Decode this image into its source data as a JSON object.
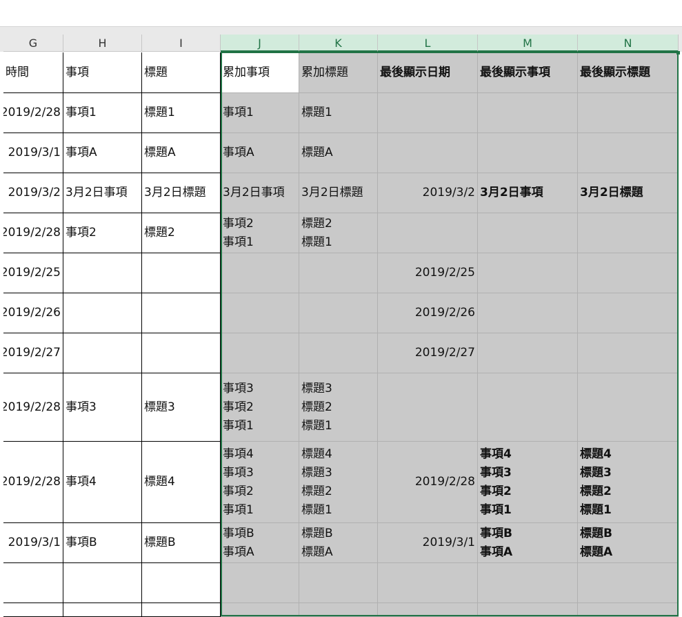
{
  "columns": [
    "G",
    "H",
    "I",
    "J",
    "K",
    "L",
    "M",
    "N"
  ],
  "rows": [
    [
      "時間",
      "事項",
      "標題",
      "累加事項",
      "累加標題",
      "最後顯示日期",
      "最後顯示事項",
      "最後顯示標題"
    ],
    [
      "2019/2/28",
      "事項1",
      "標題1",
      "事項1",
      "標題1",
      "",
      "",
      ""
    ],
    [
      "2019/3/1",
      "事項A",
      "標題A",
      "事項A",
      "標題A",
      "",
      "",
      ""
    ],
    [
      "2019/3/2",
      "3月2日事項",
      "3月2日標題",
      "3月2日事項",
      "3月2日標題",
      "2019/3/2",
      "3月2日事項",
      "3月2日標題"
    ],
    [
      "2019/2/28",
      "事項2",
      "標題2",
      "事項2\n事項1",
      "標題2\n標題1",
      "",
      "",
      ""
    ],
    [
      "2019/2/25",
      "",
      "",
      "",
      "",
      "2019/2/25",
      "",
      ""
    ],
    [
      "2019/2/26",
      "",
      "",
      "",
      "",
      "2019/2/26",
      "",
      ""
    ],
    [
      "2019/2/27",
      "",
      "",
      "",
      "",
      "2019/2/27",
      "",
      ""
    ],
    [
      "2019/2/28",
      "事項3",
      "標題3",
      "事項3\n事項2\n事項1",
      "標題3\n標題2\n標題1",
      "",
      "",
      ""
    ],
    [
      "2019/2/28",
      "事項4",
      "標題4",
      "事項4\n事項3\n事項2\n事項1",
      "標題4\n標題3\n標題2\n標題1",
      "2019/2/28",
      "事項4\n事項3\n事項2\n事項1",
      "標題4\n標題3\n標題2\n標題1"
    ],
    [
      "2019/3/1",
      "事項B",
      "標題B",
      "事項B\n事項A",
      "標題B\n標題A",
      "2019/3/1",
      "事項B\n事項A",
      "標題B\n標題A"
    ],
    [
      "",
      "",
      "",
      "",
      "",
      "",
      "",
      ""
    ],
    [
      "",
      "",
      "",
      "",
      "",
      "",
      "",
      ""
    ]
  ],
  "selected_columns": [
    "J",
    "K",
    "L",
    "M",
    "N"
  ],
  "colors": {
    "selection": "#217346",
    "header_selected_bg": "#d2ebdc",
    "selected_cell_bg": "#c9c9c9"
  }
}
